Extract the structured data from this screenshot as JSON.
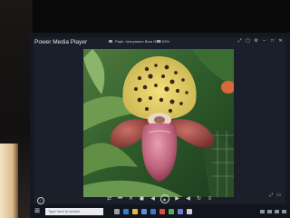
{
  "app": {
    "title": "Power Media Player"
  },
  "file": {
    "name": "Paph. henryanum Bear Gold",
    "zoom": "53%"
  },
  "taskbar": {
    "search_placeholder": "Type here to search"
  },
  "icons": {
    "title_bar": [
      "pin-icon",
      "fullscreen-icon",
      "settings-icon",
      "minimize-icon",
      "maximize-icon",
      "close-icon"
    ],
    "controls": [
      "shuffle-icon",
      "previous-icon",
      "close-icon",
      "stop-icon",
      "rewind-icon",
      "play-icon",
      "forward-icon",
      "volume-icon",
      "repeat-icon",
      "playlist-icon"
    ]
  },
  "colors": {
    "window_bg": "#1b1f2a",
    "taskbar_bg": "#12151c"
  }
}
